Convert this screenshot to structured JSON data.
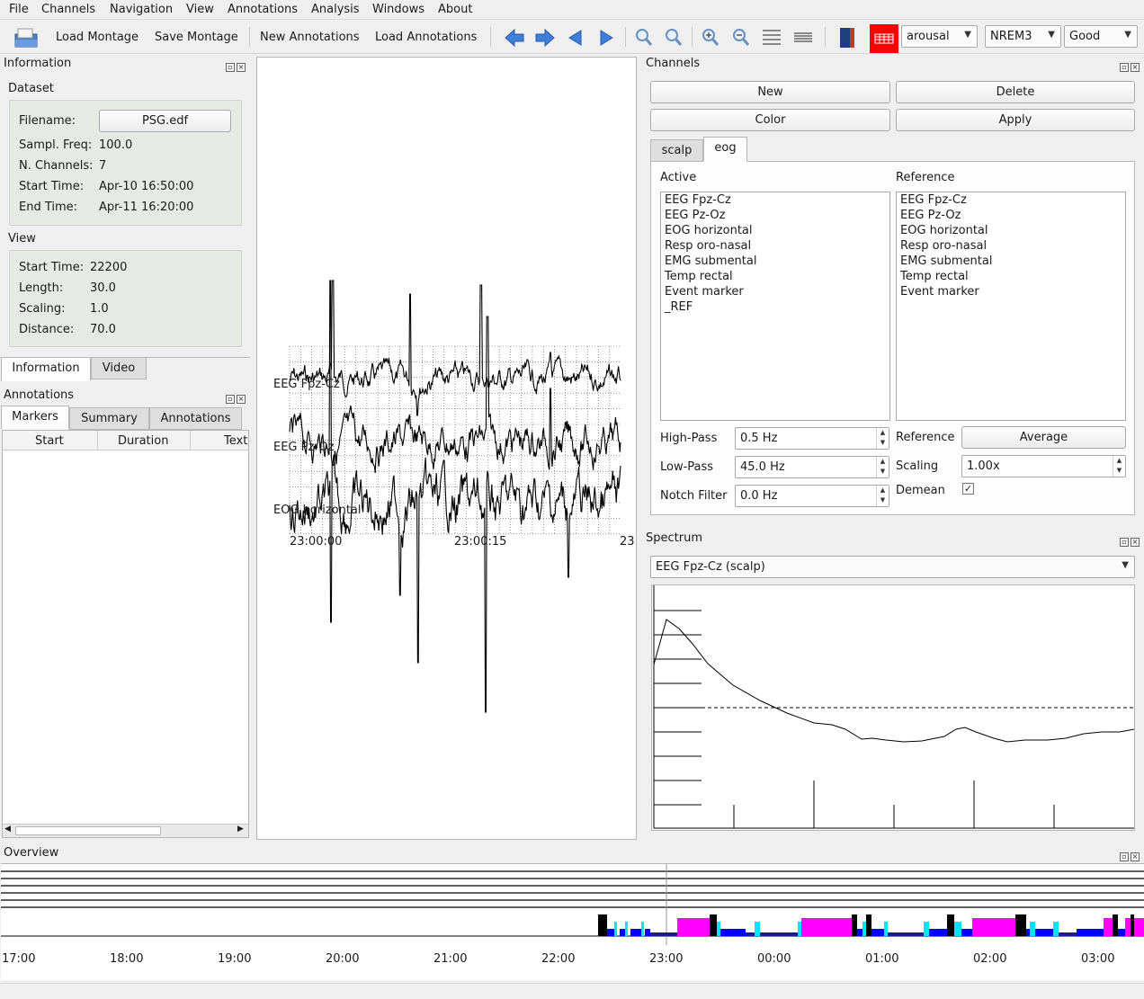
{
  "menu": [
    "File",
    "Channels",
    "Navigation",
    "View",
    "Annotations",
    "Analysis",
    "Windows",
    "About"
  ],
  "toolbar": {
    "load_montage": "Load Montage",
    "save_montage": "Save Montage",
    "new_annotations": "New Annotations",
    "load_annotations": "Load Annotations",
    "event_combo": "arousal",
    "stage_combo": "NREM3",
    "quality_combo": "Good",
    "accent": "#ff0000"
  },
  "information": {
    "title": "Information",
    "dataset_title": "Dataset",
    "filename_label": "Filename:",
    "filename_value": "PSG.edf",
    "sfreq_label": "Sampl. Freq:",
    "sfreq_value": "100.0",
    "nch_label": "N. Channels:",
    "nch_value": "7",
    "start_label": "Start Time:",
    "start_value": "Apr-10 16:50:00",
    "end_label": "End Time:",
    "end_value": "Apr-11 16:20:00",
    "view_title": "View",
    "vstart_label": "Start Time:",
    "vstart_value": "22200",
    "length_label": "Length:",
    "length_value": "30.0",
    "scaling_label": "Scaling:",
    "scaling_value": "1.0",
    "distance_label": "Distance:",
    "distance_value": "70.0",
    "tabs": [
      "Information",
      "Video"
    ]
  },
  "annotations": {
    "title": "Annotations",
    "tabs": [
      "Markers",
      "Summary",
      "Annotations"
    ],
    "columns": [
      "Start",
      "Duration",
      "Text"
    ]
  },
  "signal_view": {
    "channel_labels": [
      "EEG Fpz-Cz",
      "EEG Pz-Oz",
      "EOG horizontal"
    ],
    "time_ticks": [
      "23:00:00",
      "23:00:15",
      "23"
    ]
  },
  "channels": {
    "title": "Channels",
    "new_label": "New",
    "delete_label": "Delete",
    "color_label": "Color",
    "apply_label": "Apply",
    "tabs": [
      "scalp",
      "eog"
    ],
    "active_label": "Active",
    "reference_label": "Reference",
    "active_items": [
      "EEG Fpz-Cz",
      "EEG Pz-Oz",
      "EOG horizontal",
      "Resp oro-nasal",
      "EMG submental",
      "Temp rectal",
      "Event marker",
      "_REF"
    ],
    "reference_items": [
      "EEG Fpz-Cz",
      "EEG Pz-Oz",
      "EOG horizontal",
      "Resp oro-nasal",
      "EMG submental",
      "Temp rectal",
      "Event marker"
    ],
    "highpass_label": "High-Pass",
    "highpass_value": "0.5 Hz",
    "lowpass_label": "Low-Pass",
    "lowpass_value": "45.0 Hz",
    "notch_label": "Notch Filter",
    "notch_value": "0.0 Hz",
    "reference_combo_label": "Reference",
    "reference_button": "Average",
    "scaling_label": "Scaling",
    "scaling_value": "1.00x",
    "demean_label": "Demean",
    "demean_checked": true
  },
  "spectrum": {
    "title": "Spectrum",
    "selector": "EEG Fpz-Cz (scalp)"
  },
  "overview": {
    "title": "Overview",
    "time_labels": [
      "17:00",
      "18:00",
      "19:00",
      "20:00",
      "21:00",
      "22:00",
      "23:00",
      "00:00",
      "01:00",
      "02:00",
      "03:00"
    ],
    "stage_colors": {
      "black": "#000000",
      "blue": "#0000ff",
      "cyan": "#00e5ff",
      "magenta": "#ff00ff",
      "navy": "#1a1a8c"
    }
  }
}
